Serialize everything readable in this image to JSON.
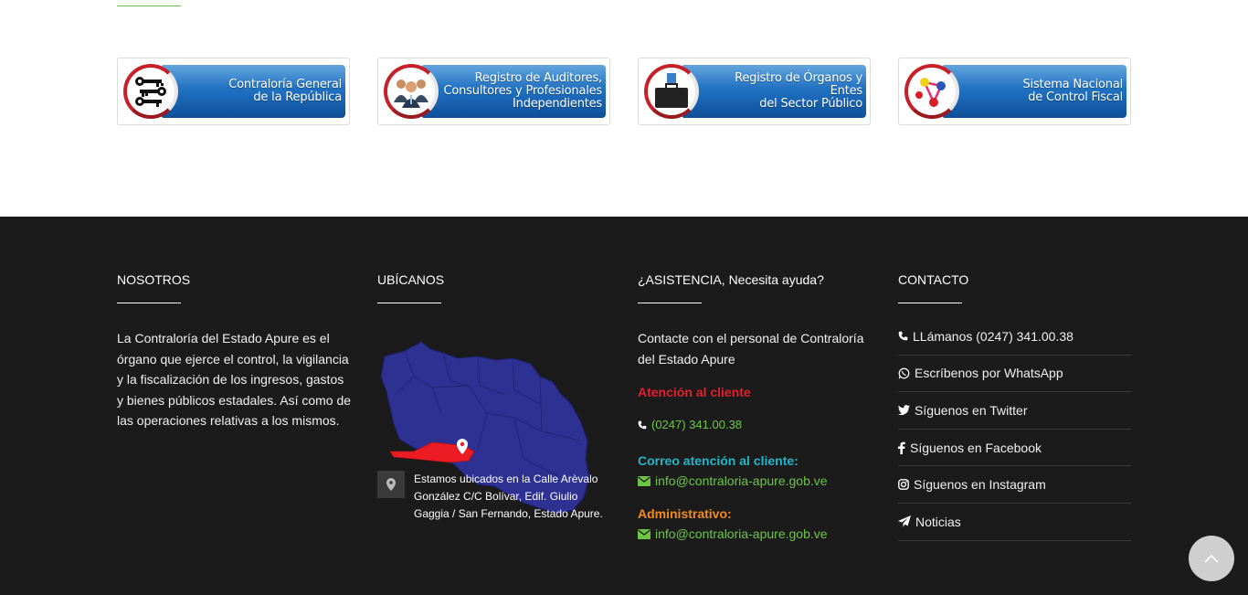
{
  "banners": [
    {
      "text": "Contraloría General\nde la República",
      "icon": "keys-icon"
    },
    {
      "text": "Registro de Auditores,\nConsultores y Profesionales\nIndependientes",
      "icon": "people-icon"
    },
    {
      "text": "Registro de Órganos y Entes\ndel Sector Público",
      "icon": "briefcase-icon"
    },
    {
      "text": "Sistema Nacional\nde Control Fiscal",
      "icon": "network-icon"
    }
  ],
  "footer": {
    "nosotros": {
      "title": "NOSOTROS",
      "text": "La Contraloría del Estado Apure es el órgano que ejerce el control, la vigilancia y la fiscalización de los ingresos, gastos y bienes públicos estadales. Así como de las operaciones relativas a los mismos."
    },
    "ubicanos": {
      "title": "UBÍCANOS",
      "address": "Estamos ubicados en la Calle Arèvalo González C/C Bolívar, Edif. Giulio Gaggia / San Fernando, Estado Apure."
    },
    "asistencia": {
      "title": "¿ASISTENCIA, Necesita ayuda?",
      "text": "Contacte con el personal de Contraloría del Estado Apure",
      "atencion_label": "Atención al cliente",
      "phone": "(0247) 341.00.38",
      "correo_label": "Correo atención al cliente:",
      "correo_email": "info@contraloria-apure.gob.ve",
      "admin_label": "Administrativo:",
      "admin_email": "info@contraloria-apure.gob.ve"
    },
    "contacto": {
      "title": "CONTACTO",
      "items": [
        {
          "label": "LLámanos (0247) 341.00.38",
          "icon": "phone-icon"
        },
        {
          "label": "Escríbenos por WhatsApp",
          "icon": "whatsapp-icon"
        },
        {
          "label": "Síguenos en Twitter",
          "icon": "twitter-icon"
        },
        {
          "label": "Síguenos en Facebook",
          "icon": "facebook-icon"
        },
        {
          "label": "Síguenos en Instagram",
          "icon": "instagram-icon"
        },
        {
          "label": "Noticias",
          "icon": "send-icon"
        }
      ]
    }
  },
  "colors": {
    "footer_bg": "#1b1b1b",
    "accent_green": "#6cc644",
    "label_red": "#e2202f",
    "label_cyan": "#1fb6c8",
    "label_orange": "#f28c16",
    "map_blue": "#2e3192",
    "map_highlight": "#ed1c24"
  },
  "scroll_top": {
    "icon": "chevron-up-icon"
  }
}
